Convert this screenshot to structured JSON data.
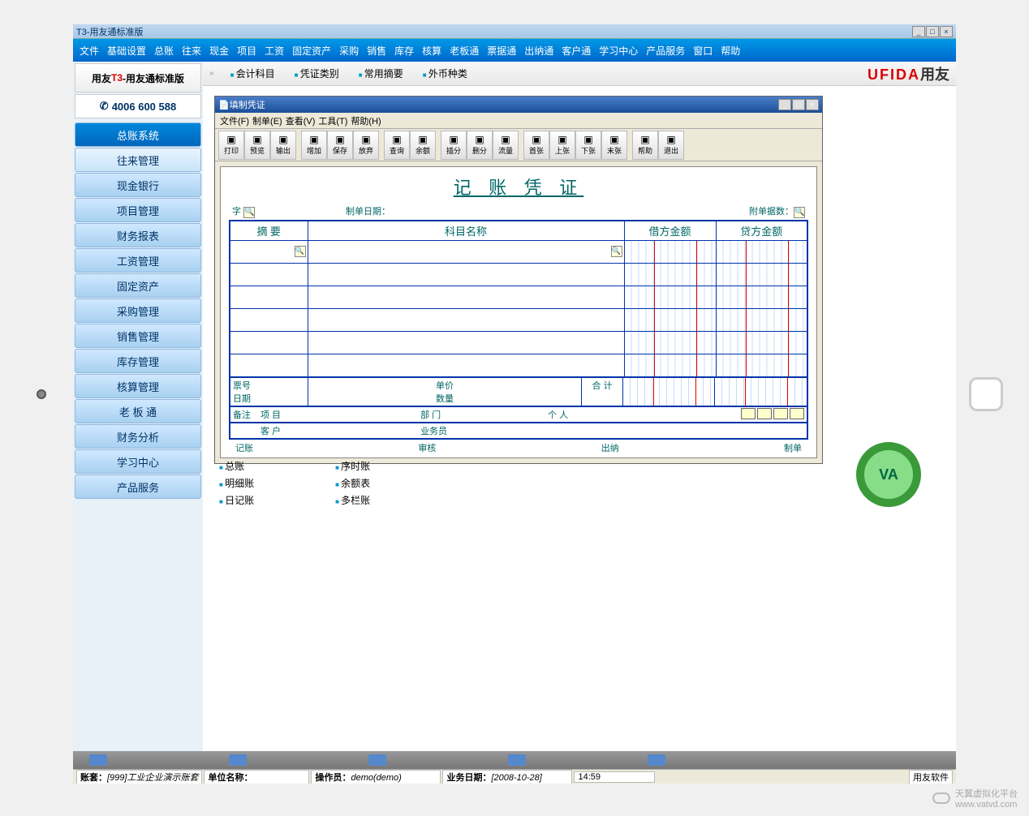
{
  "outer_window": {
    "title": "T3-用友通标准版"
  },
  "outer_menu": [
    "文件",
    "基础设置",
    "总账",
    "往来",
    "现金",
    "项目",
    "工资",
    "固定资产",
    "采购",
    "销售",
    "库存",
    "核算",
    "老板通",
    "票据通",
    "出纳通",
    "客户通",
    "学习中心",
    "产品服务",
    "窗口",
    "帮助"
  ],
  "sidebar": {
    "logo_prefix": "用友",
    "logo_red": "T3",
    "logo_suffix": "-用友通标准版",
    "phone": "4006 600 588",
    "items": [
      {
        "label": "总账系统",
        "active": true
      },
      {
        "label": "往来管理",
        "sub": true
      },
      {
        "label": "现金银行"
      },
      {
        "label": "项目管理"
      },
      {
        "label": "财务报表"
      },
      {
        "label": "工资管理"
      },
      {
        "label": "固定资产"
      },
      {
        "label": "采购管理"
      },
      {
        "label": "销售管理"
      },
      {
        "label": "库存管理"
      },
      {
        "label": "核算管理"
      },
      {
        "label": "老 板 通"
      },
      {
        "label": "财务分析"
      },
      {
        "label": "学习中心"
      },
      {
        "label": "产品服务"
      }
    ]
  },
  "breadcrumb": [
    "会计科目",
    "凭证类别",
    "常用摘要",
    "外币种类"
  ],
  "ufida_logo": {
    "en": "UFIDA",
    "cn": "用友"
  },
  "inner_window": {
    "title": "填制凭证",
    "menu": [
      "文件(F)",
      "制单(E)",
      "查看(V)",
      "工具(T)",
      "帮助(H)"
    ],
    "toolbar": [
      "打印",
      "预览",
      "输出",
      "增加",
      "保存",
      "放弃",
      "查询",
      "余额",
      "插分",
      "删分",
      "流量",
      "首张",
      "上张",
      "下张",
      "末张",
      "帮助",
      "退出"
    ]
  },
  "voucher": {
    "title": "记 账 凭 证",
    "meta": {
      "zi": "字",
      "date_label": "制单日期：",
      "attach_label": "附单据数："
    },
    "headers": [
      "摘 要",
      "科目名称",
      "借方金额",
      "贷方金额"
    ],
    "foot1": {
      "tickno": "票号",
      "date": "日期",
      "price": "单价",
      "qty": "数量",
      "total": "合 计"
    },
    "foot2": {
      "remark": "备注",
      "proj": "项 目",
      "cust": "客 户",
      "dept": "部 门",
      "biz": "业务员",
      "person": "个 人"
    },
    "sig": [
      "记账",
      "审核",
      "出纳",
      "制单"
    ]
  },
  "book_links": {
    "col1": [
      "总账",
      "明细账",
      "日记账"
    ],
    "col2": [
      "序时账",
      "余额表",
      "多栏账"
    ]
  },
  "status": {
    "zt_label": "账套：",
    "zt": "[999]工业企业演示账套",
    "dw_label": "单位名称：",
    "dw": "",
    "op_label": "操作员：",
    "op": "demo(demo)",
    "date_label": "业务日期：",
    "date": "[2008-10-28]",
    "time": "14:59",
    "brand": "用友软件"
  },
  "watermark": {
    "name": "天翼虚拟化平台",
    "url": "www.vatvd.com"
  }
}
